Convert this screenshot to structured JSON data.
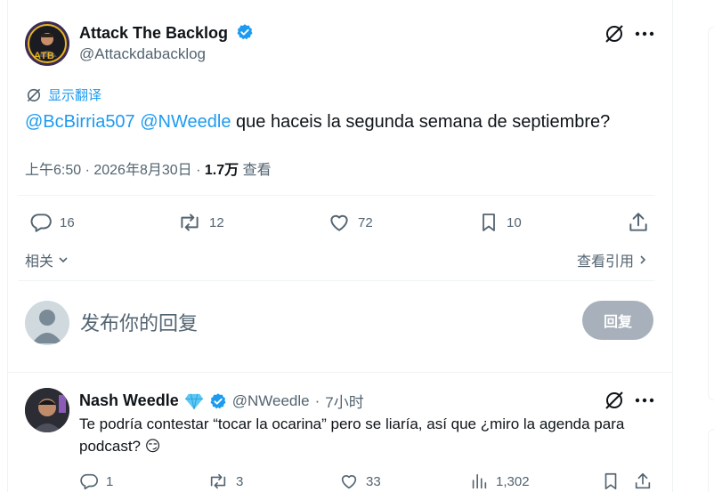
{
  "main_tweet": {
    "author_name": "Attack The Backlog",
    "author_handle": "@Attackdabacklog",
    "avatar_text": "ATB",
    "translate_label": "显示翻译",
    "mention1": "@BcBirria507",
    "mention2": "@NWeedle",
    "body": "que haceis la segunda semana de septiembre?",
    "time": "上午6:50 · 2026年8月30日 · ",
    "views_count": "1.7万",
    "views_label": " 查看",
    "actions": {
      "replies": "16",
      "retweets": "12",
      "likes": "72",
      "bookmarks": "10"
    },
    "related_label": "相关",
    "view_quotes_label": "查看引用"
  },
  "compose": {
    "placeholder": "发布你的回复",
    "reply_button": "回复"
  },
  "reply_tweet": {
    "author_name": "Nash Weedle",
    "author_handle": "@NWeedle",
    "separator": "·",
    "time_ago": "7小时",
    "body": "Te podría contestar “tocar la ocarina” pero se liaría, así que ¿miro la agenda para podcast? 😏",
    "actions": {
      "replies": "1",
      "retweets": "3",
      "likes": "33",
      "views": "1,302"
    }
  },
  "colors": {
    "accent": "#1d9bf0",
    "text": "#0f1419",
    "muted": "#536471",
    "border": "#eff3f4"
  }
}
